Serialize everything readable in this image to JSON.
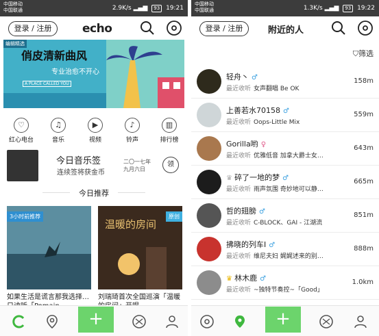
{
  "left": {
    "status": {
      "carrier1": "中国移动",
      "carrier2": "中国联通",
      "speed": "2.9K/s",
      "battery": "93",
      "time": "19:21"
    },
    "header": {
      "login": "登录 / 注册",
      "logo": "echo"
    },
    "banner": {
      "tag": "编辑精选",
      "title": "俏皮清新曲风",
      "subtitle": "专业治愈不开心",
      "caption": "A PLACE CALLED YOU"
    },
    "categories": [
      {
        "label": "红心电台",
        "icon": "heart-icon"
      },
      {
        "label": "音乐",
        "icon": "music-note-icon"
      },
      {
        "label": "视频",
        "icon": "video-icon"
      },
      {
        "label": "铃声",
        "icon": "bell-icon"
      },
      {
        "label": "排行榜",
        "icon": "chart-icon"
      }
    ],
    "daily": {
      "title": "今日音乐签",
      "subtitle": "连续签将获金币",
      "date": "二〇一七年 九月六日",
      "claim": "领"
    },
    "section_title": "今日推荐",
    "cards": [
      {
        "badge": "3小时前推荐",
        "caption": "如果生活是谎言那我选择…只迹听「Pomain",
        "image_text": ""
      },
      {
        "badge": "原创",
        "caption": "刘瑞琦首次全国巡演「温暖的房间」开唱",
        "image_text": "温暖的房间"
      }
    ]
  },
  "right": {
    "status": {
      "carrier1": "中国移动",
      "carrier2": "中国联通",
      "speed": "1.3K/s",
      "battery": "93",
      "time": "19:22"
    },
    "header": {
      "login": "登录 / 注册",
      "title": "附近的人"
    },
    "filter": "筛选",
    "recent_label": "最近收听",
    "people": [
      {
        "name": "轻舟丶",
        "gender": "♂",
        "song": "女声翻唱 Be OK",
        "distance": "158m",
        "crown": false
      },
      {
        "name": "上善若水70158",
        "gender": "♂",
        "song": "Oops-Little Mix",
        "distance": "559m",
        "crown": false
      },
      {
        "name": "Gorilla哟",
        "gender": "♀",
        "song": "优雅低音 加拿大爵士女…",
        "distance": "643m",
        "crown": false
      },
      {
        "name": "碎了一地的梦",
        "gender": "♂",
        "song": "雨声氛围 奇妙地可以静…",
        "distance": "665m",
        "crown": true
      },
      {
        "name": "哲的翅膀",
        "gender": "♂",
        "song": "C-BLOCK、GAI - 江湖流",
        "distance": "851m",
        "crown": false
      },
      {
        "name": "拂晓的列车I",
        "gender": "♂",
        "song": "维尼夫妇 娓娓述来的别…",
        "distance": "888m",
        "crown": false
      },
      {
        "name": "林木鹿",
        "gender": "♂",
        "song": "~独特节奏控~「Good」",
        "distance": "1.0km",
        "crown": true
      }
    ]
  },
  "colors": {
    "accent": "#6cd46c",
    "male": "#3aa0e0",
    "female": "#e05a8a",
    "badge": "#2f8fd0"
  }
}
